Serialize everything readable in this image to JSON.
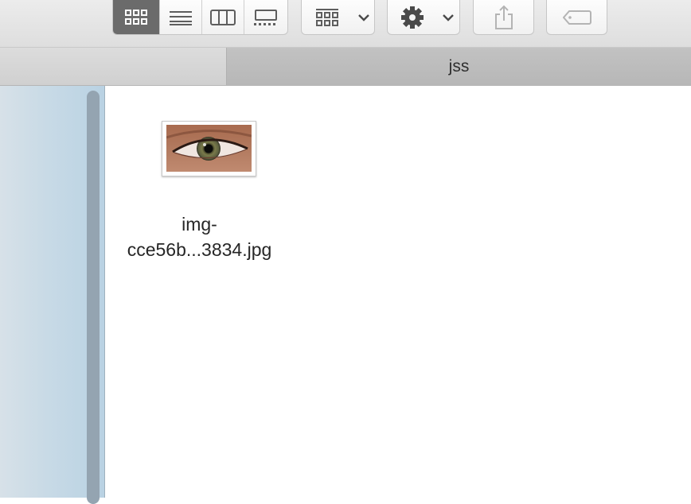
{
  "toolbar": {
    "view_modes": [
      {
        "name": "icon-view",
        "active": true
      },
      {
        "name": "list-view",
        "active": false
      },
      {
        "name": "column-view",
        "active": false
      },
      {
        "name": "gallery-view",
        "active": false
      }
    ],
    "group_button": {
      "icon": "group-grid-icon",
      "menu_icon": "chevron-down-icon"
    },
    "action_button": {
      "icon": "gear-icon",
      "menu_icon": "chevron-down-icon"
    },
    "share_button": {
      "icon": "share-icon"
    },
    "tag_button": {
      "icon": "tag-icon"
    },
    "accent_color": "#6b6b6b"
  },
  "tabs": {
    "active_title": "jss"
  },
  "sidebar": {
    "colors": [
      "#d7e1e8",
      "#b9d2e3"
    ]
  },
  "files": [
    {
      "name_line1": "img-",
      "name_line2": "cce56b...3834.jpg",
      "thumbnail": "eye-photo"
    }
  ]
}
